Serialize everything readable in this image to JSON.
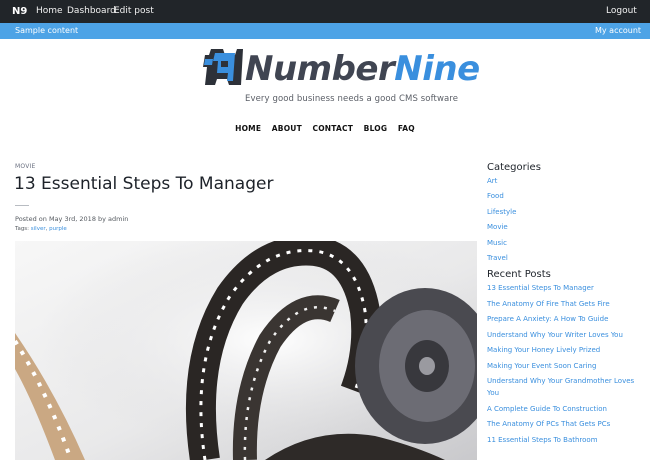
{
  "adminbar": {
    "brand": "N9",
    "home": "Home",
    "dashboard": "Dashboard",
    "edit_post": "Edit post",
    "logout": "Logout"
  },
  "subbar": {
    "sample": "Sample content",
    "account": "My account"
  },
  "logo": {
    "name_part1": "Number",
    "name_part2": "Nine",
    "tagline": "Every good business needs a good CMS software"
  },
  "nav": [
    "HOME",
    "ABOUT",
    "CONTACT",
    "BLOG",
    "FAQ"
  ],
  "post": {
    "category": "MOVIE",
    "title": "13 Essential Steps To Manager",
    "posted": "Posted on May 3rd, 2018 by admin",
    "tags_label": "Tags:",
    "tags": [
      "silver",
      "purple"
    ]
  },
  "sidebar": {
    "categories_title": "Categories",
    "categories": [
      "Art",
      "Food",
      "Lifestyle",
      "Movie",
      "Music",
      "Travel"
    ],
    "recent_title": "Recent Posts",
    "recent": [
      "13 Essential Steps To Manager",
      "The Anatomy Of Fire That Gets Fire",
      "Prepare A Anxiety: A How To Guide",
      "Understand Why Your Writer Loves You",
      "Making Your Honey Lively Prized",
      "Making Your Event Soon Caring",
      "Understand Why Your Grandmother Loves",
      "You",
      "A Complete Guide To Construction",
      "The Anatomy Of PCs That Gets PCs",
      "11 Essential Steps To Bathroom"
    ]
  },
  "colors": {
    "adminbar": "#212529",
    "subbar": "#4da3e6",
    "accent": "#3a8fde",
    "logo_dark": "#404552"
  }
}
